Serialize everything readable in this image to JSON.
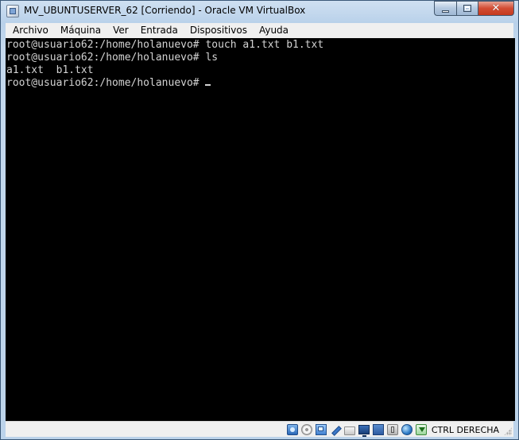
{
  "window": {
    "title": "MV_UBUNTUSERVER_62 [Corriendo] - Oracle VM VirtualBox",
    "controls": {
      "minimize_glyph": "_",
      "maximize_glyph": "□",
      "close_glyph": "✕"
    }
  },
  "menu": {
    "items": [
      "Archivo",
      "Máquina",
      "Ver",
      "Entrada",
      "Dispositivos",
      "Ayuda"
    ]
  },
  "terminal": {
    "lines": [
      "root@usuario62:/home/holanuevo# touch a1.txt b1.txt",
      "root@usuario62:/home/holanuevo# ls",
      "a1.txt  b1.txt",
      "root@usuario62:/home/holanuevo# "
    ]
  },
  "statusbar": {
    "host_key": "CTRL DERECHA",
    "icons": [
      "hard-disk-icon",
      "optical-drive-icon",
      "network-icon",
      "usb-pen-icon",
      "shared-folders-icon",
      "display-icon",
      "storage-icon",
      "usb-icon",
      "network-globe-icon",
      "mouse-integration-icon"
    ]
  },
  "colors": {
    "console_bg": "#000000",
    "console_fg": "#d3d3d3",
    "close_button": "#c43a1f",
    "titlebar": "#b9d1ea"
  }
}
